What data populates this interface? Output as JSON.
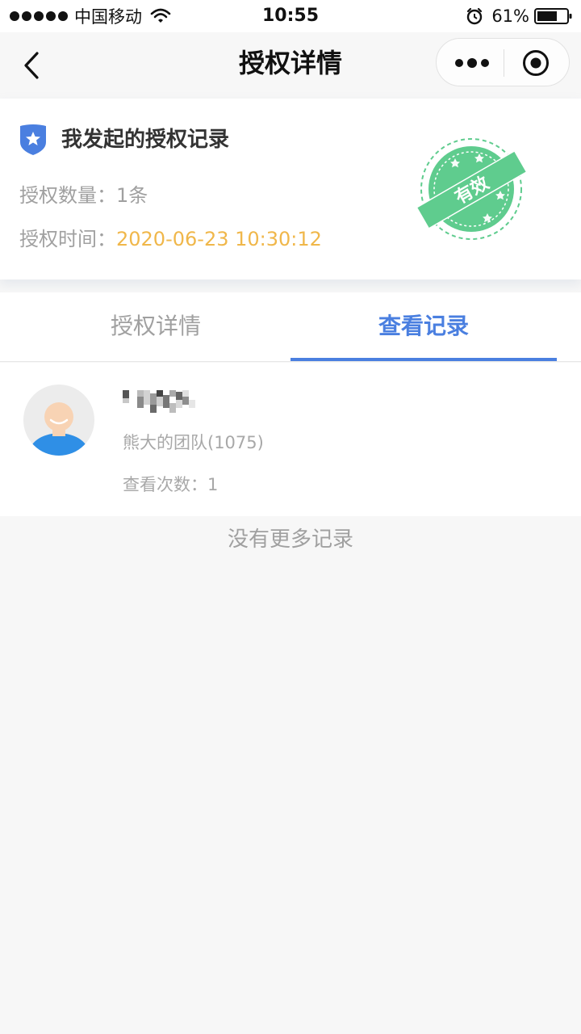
{
  "status_bar": {
    "carrier": "中国移动",
    "time": "10:55",
    "battery": "61%"
  },
  "nav": {
    "title": "授权详情"
  },
  "summary": {
    "title": "我发起的授权记录",
    "count_label": "授权数量：",
    "count_value": "1条",
    "time_label": "授权时间：",
    "time_value": "2020-06-23 10:30:12",
    "stamp_text": "有效"
  },
  "tabs": [
    {
      "label": "授权详情",
      "active": false
    },
    {
      "label": "查看记录",
      "active": true
    }
  ],
  "records": [
    {
      "team": "熊大的团队(1075)",
      "view_count": "查看次数：1"
    }
  ],
  "footer": {
    "no_more": "没有更多记录"
  },
  "colors": {
    "accent": "#4a7fe0",
    "stamp_green": "#5fcc8e",
    "time_orange": "#f0b74a",
    "muted_text": "#a0a0a0"
  }
}
